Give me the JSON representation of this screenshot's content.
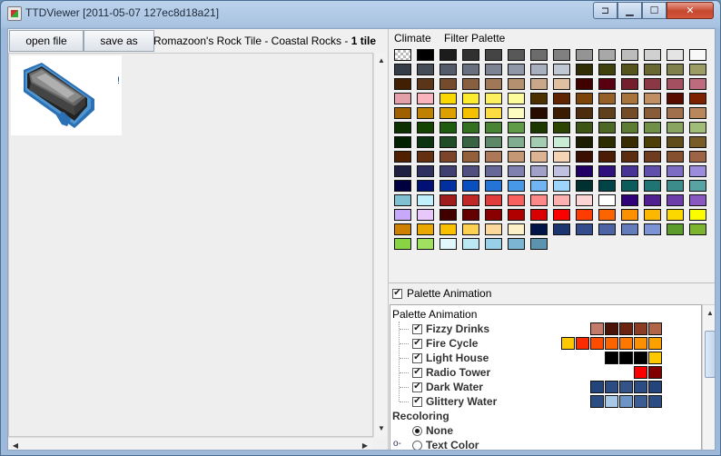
{
  "window": {
    "title": "TTDViewer [2011-05-07 127ec8d18a21]"
  },
  "toolbar": {
    "open_label": "open file",
    "save_label": "save as",
    "tile_prefix": "Romazoon's Rock Tile - Coastal Rocks - ",
    "tile_bold": "1 tile"
  },
  "sprite_mark": "!",
  "menu": {
    "climate": "Climate",
    "filter": "Filter Palette"
  },
  "palette": {
    "rows": [
      [
        "checker",
        "#000000",
        "#1c1c1c",
        "#303030",
        "#444444",
        "#585858",
        "#6c6c6c",
        "#808080",
        "#949494",
        "#a8a8a8",
        "#bcbcbc",
        "#d0d0d0",
        "#e4e4e4",
        "#f8f8f8"
      ],
      [
        "#343c48",
        "#444c58",
        "#545c6c",
        "#687080",
        "#7c8494",
        "#9098a8",
        "#a8b0c0",
        "#c0c8d4",
        "#302c04",
        "#40400c",
        "#54541c",
        "#686830",
        "#80804c",
        "#9c9c64"
      ],
      [
        "#402000",
        "#5c3418",
        "#744c2c",
        "#886040",
        "#a07858",
        "#b49070",
        "#c8a888",
        "#e0c0a0",
        "#400000",
        "#580010",
        "#74202c",
        "#8c3844",
        "#a45060",
        "#bc6c7c"
      ],
      [
        "#e4a0a8",
        "#fcb4bc",
        "#f8d800",
        "#fcec30",
        "#fcf060",
        "#fcfc9c",
        "#4c3000",
        "#602400",
        "#7c4408",
        "#946028",
        "#a8743c",
        "#c09064",
        "#580c00",
        "#7c2000"
      ],
      [
        "#a06000",
        "#c08000",
        "#dca000",
        "#f4c000",
        "#fcdc40",
        "#fcfcc0",
        "#280c00",
        "#3c1c00",
        "#4c2c0c",
        "#60401c",
        "#744c28",
        "#885c38",
        "#a0704c",
        "#b8885c"
      ],
      [
        "#0c3000",
        "#144400",
        "#205c10",
        "#347020",
        "#488434",
        "#609c48",
        "#1c3800",
        "#2c4400",
        "#3c5414",
        "#4c6824",
        "#5c7c34",
        "#709048",
        "#88a460",
        "#a0bc78"
      ],
      [
        "#002000",
        "#0c3410",
        "#204c28",
        "#386444",
        "#5c8868",
        "#80ac90",
        "#a4ccb0",
        "#c8ecd4",
        "#1c1c00",
        "#2c2c00",
        "#382c00",
        "#4c4008",
        "#604c18",
        "#785c28"
      ],
      [
        "#502000",
        "#643010",
        "#7c4428",
        "#94603c",
        "#ac7858",
        "#c49874",
        "#dcb494",
        "#f4d4b4",
        "#3c1000",
        "#4c1c04",
        "#5c2c10",
        "#703c20",
        "#845030",
        "#9c6444"
      ],
      [
        "#202040",
        "#303060",
        "#404070",
        "#505080",
        "#686898",
        "#8080b0",
        "#a0a0c8",
        "#c0c0e0",
        "#200064",
        "#30107c",
        "#483494",
        "#6050ac",
        "#7c6cc4",
        "#9c8cdc"
      ],
      [
        "#000040",
        "#001074",
        "#0030a0",
        "#0850c0",
        "#2474d8",
        "#4898e8",
        "#70b4f4",
        "#9cd4fc",
        "#003030",
        "#004448",
        "#0c5c5c",
        "#207474",
        "#3c8c8c",
        "#58a4a4"
      ],
      [
        "#80c0d0",
        "#c0f0fc",
        "#a01c1c",
        "#c02828",
        "#e03c3c",
        "#f86060",
        "#fc8888",
        "#fcb0b0",
        "#fcd4d4",
        "#ffffff",
        "#300078",
        "#502090",
        "#6c3ca8",
        "#8858c0"
      ],
      [
        "#c8a8f8",
        "#e8c8fc",
        "#400000",
        "#640000",
        "#880000",
        "#b00000",
        "#d80000",
        "#fc0000",
        "#fc3c00",
        "#fc6400",
        "#fc9000",
        "#fcb800",
        "#fcd800",
        "#fcfc00"
      ],
      [
        "#d08000",
        "#e8a800",
        "#f8c000",
        "#fcd050",
        "#fcd89c",
        "#fcf0c8",
        "#001448",
        "#1c3470",
        "#344c8c",
        "#4c64a4",
        "#647cbc",
        "#7c94d4",
        "#5c9c2c",
        "#7cb430"
      ],
      [
        "#88d444",
        "#a0e060",
        "#e0f8fc",
        "#bce8f4",
        "#98d0e8",
        "#7cb4d4",
        "#5c94b0"
      ]
    ]
  },
  "animation_toggle": "Palette Animation",
  "tree": {
    "header": "Palette Animation",
    "items": [
      {
        "label": "Fizzy Drinks",
        "colors": [
          "#c47a6a",
          "#4c1408",
          "#6c2410",
          "#8c3c24",
          "#b06448"
        ]
      },
      {
        "label": "Fire Cycle",
        "colors": [
          "#fcc800",
          "#fc2c00",
          "#fc4c00",
          "#fc6400",
          "#fc7800",
          "#fc9000",
          "#fca000"
        ]
      },
      {
        "label": "Light House",
        "colors": [
          "#000000",
          "#000000",
          "#000000",
          "#fcc800"
        ]
      },
      {
        "label": "Radio Tower",
        "colors": [
          "#fc0000",
          "#800000"
        ]
      },
      {
        "label": "Dark Water",
        "colors": [
          "#24447c",
          "#2c4c84",
          "#345488",
          "#2c4c84",
          "#24447c"
        ]
      },
      {
        "label": "Glittery Water",
        "colors": [
          "#2c4c84",
          "#a8c8e8",
          "#6c94c4",
          "#3c5c94",
          "#2c4c84"
        ]
      }
    ],
    "recolor_header": "Recoloring",
    "recolor_items": [
      "None",
      "Text Color"
    ]
  }
}
